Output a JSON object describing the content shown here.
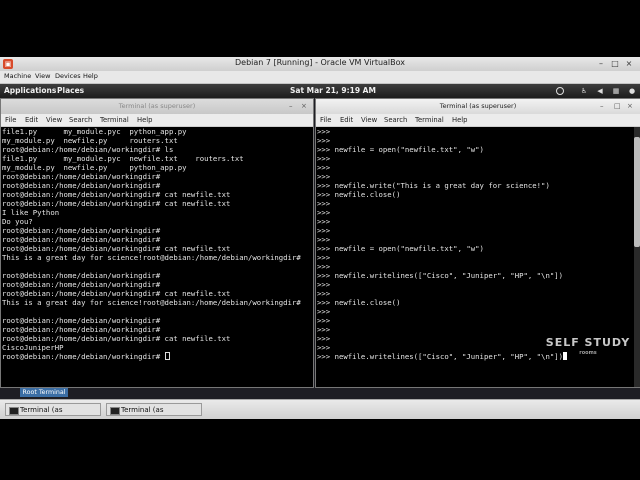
{
  "vbox": {
    "title": "Debian 7 [Running] - Oracle VM VirtualBox",
    "menu": [
      "Machine",
      "View",
      "Devices",
      "Help"
    ]
  },
  "panel": {
    "applications": "Applications",
    "places": "Places",
    "datetime": "Sat Mar 21,  9:19 AM"
  },
  "left_terminal": {
    "title": "Terminal (as superuser)",
    "menu": [
      "File",
      "Edit",
      "View",
      "Search",
      "Terminal",
      "Help"
    ],
    "lines": [
      "file1.py      my_module.pyc  python_app.py",
      "my_module.py  newfile.py     routers.txt",
      "root@debian:/home/debian/workingdir# ls",
      "file1.py      my_module.pyc  newfile.txt    routers.txt",
      "my_module.py  newfile.py     python_app.py",
      "root@debian:/home/debian/workingdir#",
      "root@debian:/home/debian/workingdir#",
      "root@debian:/home/debian/workingdir# cat newfile.txt",
      "root@debian:/home/debian/workingdir# cat newfile.txt",
      "I like Python",
      "Do you?",
      "root@debian:/home/debian/workingdir#",
      "root@debian:/home/debian/workingdir#",
      "root@debian:/home/debian/workingdir# cat newfile.txt",
      "This is a great day for science!root@debian:/home/debian/workingdir#",
      "",
      "root@debian:/home/debian/workingdir#",
      "root@debian:/home/debian/workingdir#",
      "root@debian:/home/debian/workingdir# cat newfile.txt",
      "This is a great day for science!root@debian:/home/debian/workingdir#",
      "",
      "root@debian:/home/debian/workingdir#",
      "root@debian:/home/debian/workingdir#",
      "root@debian:/home/debian/workingdir# cat newfile.txt",
      "CiscoJuniperHP",
      "root@debian:/home/debian/workingdir# "
    ]
  },
  "right_terminal": {
    "title": "Terminal (as superuser)",
    "menu": [
      "File",
      "Edit",
      "View",
      "Search",
      "Terminal",
      "Help"
    ],
    "lines": [
      ">>>",
      ">>>",
      ">>> newfile = open(\"newfile.txt\", \"w\")",
      ">>>",
      ">>>",
      ">>>",
      ">>> newfile.write(\"This is a great day for science!\")",
      ">>> newfile.close()",
      ">>>",
      ">>>",
      ">>>",
      ">>>",
      ">>>",
      ">>> newfile = open(\"newfile.txt\", \"w\")",
      ">>>",
      ">>>",
      ">>> newfile.writelines([\"Cisco\", \"Juniper\", \"HP\", \"\\n\"])",
      ">>>",
      ">>>",
      ">>> newfile.close()",
      ">>>",
      ">>>",
      ">>>",
      ">>>",
      ">>>",
      ">>> newfile.writelines([\"Cisco\", \"Juniper\", \"HP\", \"\\n\"])"
    ]
  },
  "tooltip": "Root Terminal",
  "taskbar": [
    "Terminal (as superuser)",
    "Terminal (as superuser)"
  ],
  "watermark": {
    "main": "SELF STUDY",
    "sub": "rooms"
  },
  "colors": {
    "panel_bg": "#2a2a2a",
    "terminal_bg": "#000000",
    "tooltip_bg": "#3b6ea5"
  }
}
